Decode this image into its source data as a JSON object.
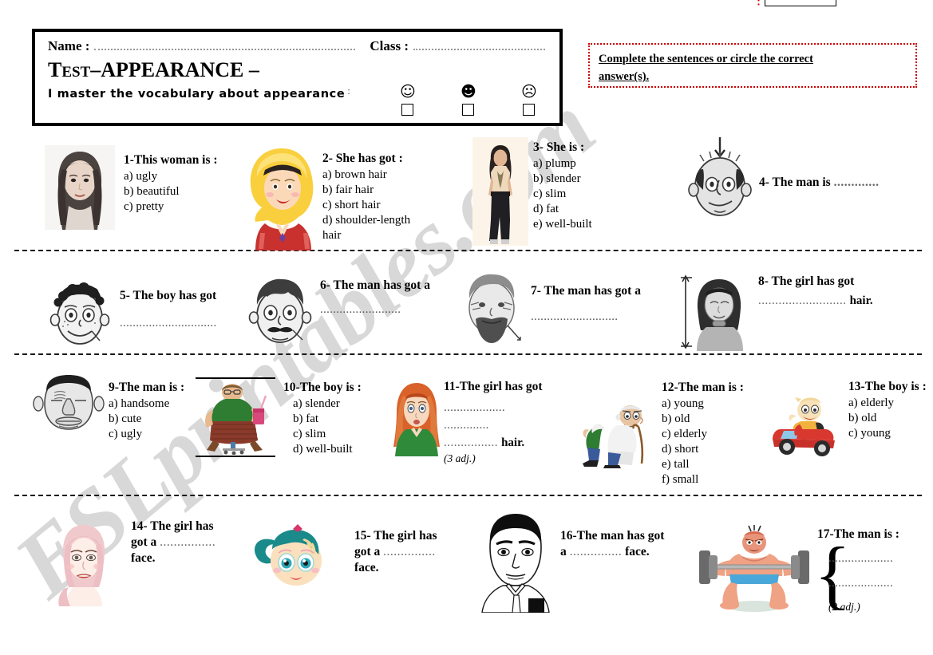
{
  "header": {
    "name_label": "Name :",
    "class_label": "Class :",
    "title": "TEST –APPEARANCE –",
    "title_lead": "T",
    "title_small": "EST",
    "title_rest": "–APPEARANCE –",
    "mastery_text": "I master the vocabulary about appearance",
    "mastery_colon": ":",
    "faces": [
      {
        "name": "happy-face",
        "glyph": "☺"
      },
      {
        "name": "neutral-face",
        "glyph": "☻"
      },
      {
        "name": "sad-face",
        "glyph": "☹"
      }
    ]
  },
  "instruction": {
    "line1": "Complete the sentences or circle the correct",
    "line2": "answer(s)."
  },
  "watermark": {
    "text": "ESLprintables.com"
  },
  "questions": [
    {
      "id": "q1",
      "title": "1-This woman is :",
      "options": [
        "a) ugly",
        "b) beautiful",
        "c) pretty"
      ],
      "image": "woman-long-dark-hair"
    },
    {
      "id": "q2",
      "title": "2- She has got :",
      "options": [
        "a) brown hair",
        "b) fair hair",
        "c) short hair",
        "d) shoulder-length",
        "hair"
      ],
      "image": "blonde-cartoon-woman"
    },
    {
      "id": "q3",
      "title": "3- She is :",
      "options": [
        "a) plump",
        "b) slender",
        "c) slim",
        "d) fat",
        "e) well-built"
      ],
      "image": "slim-standing-woman"
    },
    {
      "id": "q4",
      "title": "4- The man is",
      "blank": ".............",
      "image": "bald-man-face"
    },
    {
      "id": "q5",
      "title": "5- The boy has got",
      "blank": "..............................",
      "image": "curly-hair-boy-face"
    },
    {
      "id": "q6",
      "title": "6- The man has got a",
      "blank": ".........................",
      "image": "moustache-man-face"
    },
    {
      "id": "q7",
      "title": "7- The man has got a",
      "blank": "...........................",
      "image": "bearded-man-face"
    },
    {
      "id": "q8",
      "title": "8- The girl has got",
      "blank": "..........................",
      "suffix": "hair.",
      "image": "straight-hair-girl"
    },
    {
      "id": "q9",
      "title": "9-The man is :",
      "options": [
        "a) handsome",
        "b) cute",
        "c) ugly"
      ],
      "image": "ugly-man-face"
    },
    {
      "id": "q10",
      "title": "10-The boy is :",
      "options": [
        "a)   slender",
        "b)   fat",
        "c)   slim",
        "d)   well-built"
      ],
      "image": "fat-boy-on-chair"
    },
    {
      "id": "q11",
      "title": "11-The girl has got",
      "blanks": [
        "...................",
        "..............",
        "................"
      ],
      "suffix": "hair.",
      "note": "(3 adj.)",
      "image": "red-hair-girl"
    },
    {
      "id": "q12",
      "title": "12-The man is :",
      "options": [
        "a) young",
        "b) old",
        "c) elderly",
        "d) short",
        "e) tall",
        "f) small"
      ],
      "image": "old-man-with-cane"
    },
    {
      "id": "q13",
      "title": "13-The boy is :",
      "options": [
        "a) elderly",
        "b) old",
        "c) young"
      ],
      "image": "baby-in-toy-car"
    },
    {
      "id": "q14",
      "title": "14- The girl has",
      "line2_prefix": "got a",
      "blank": "................",
      "suffix": "face.",
      "image": "pretty-girl-face"
    },
    {
      "id": "q15",
      "title": "15- The girl has",
      "line2_prefix": "got a",
      "blank": "...............",
      "suffix": "face.",
      "image": "round-face-cartoon-girl"
    },
    {
      "id": "q16",
      "title": "16-The man has got",
      "line2_prefix": "a",
      "blank": "...............",
      "suffix": "face.",
      "image": "square-face-man"
    },
    {
      "id": "q17",
      "title": "17-The man is :",
      "blanks": [
        "....................",
        "...................."
      ],
      "note": "(2 adj.)",
      "image": "bodybuilder-weightlifter"
    }
  ]
}
